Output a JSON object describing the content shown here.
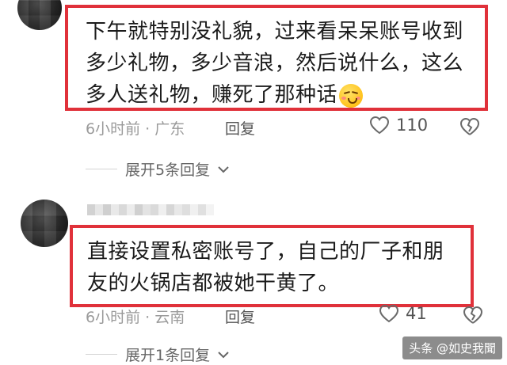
{
  "comments": [
    {
      "text": "下午就特别没礼貌，过来看呆呆账号收到多少礼物，多少音浪，然后说什么，这么多人送礼物，赚死了那种话",
      "emoji": "smirk-emoji",
      "time_location": "6小时前 · 广东",
      "reply_label": "回复",
      "likes": "110",
      "expand_label": "展开5条回复"
    },
    {
      "username": "",
      "text": "直接设置私密账号了，自己的厂子和朋友的火锅店都被她干黄了。",
      "time_location": "6小时前 · 云南",
      "reply_label": "回复",
      "likes": "41",
      "expand_label": "展开1条回复"
    }
  ],
  "watermark": "头条 @如史我聞",
  "colors": {
    "highlight_border": "#e0313a",
    "meta_text": "#9a9a9a"
  }
}
